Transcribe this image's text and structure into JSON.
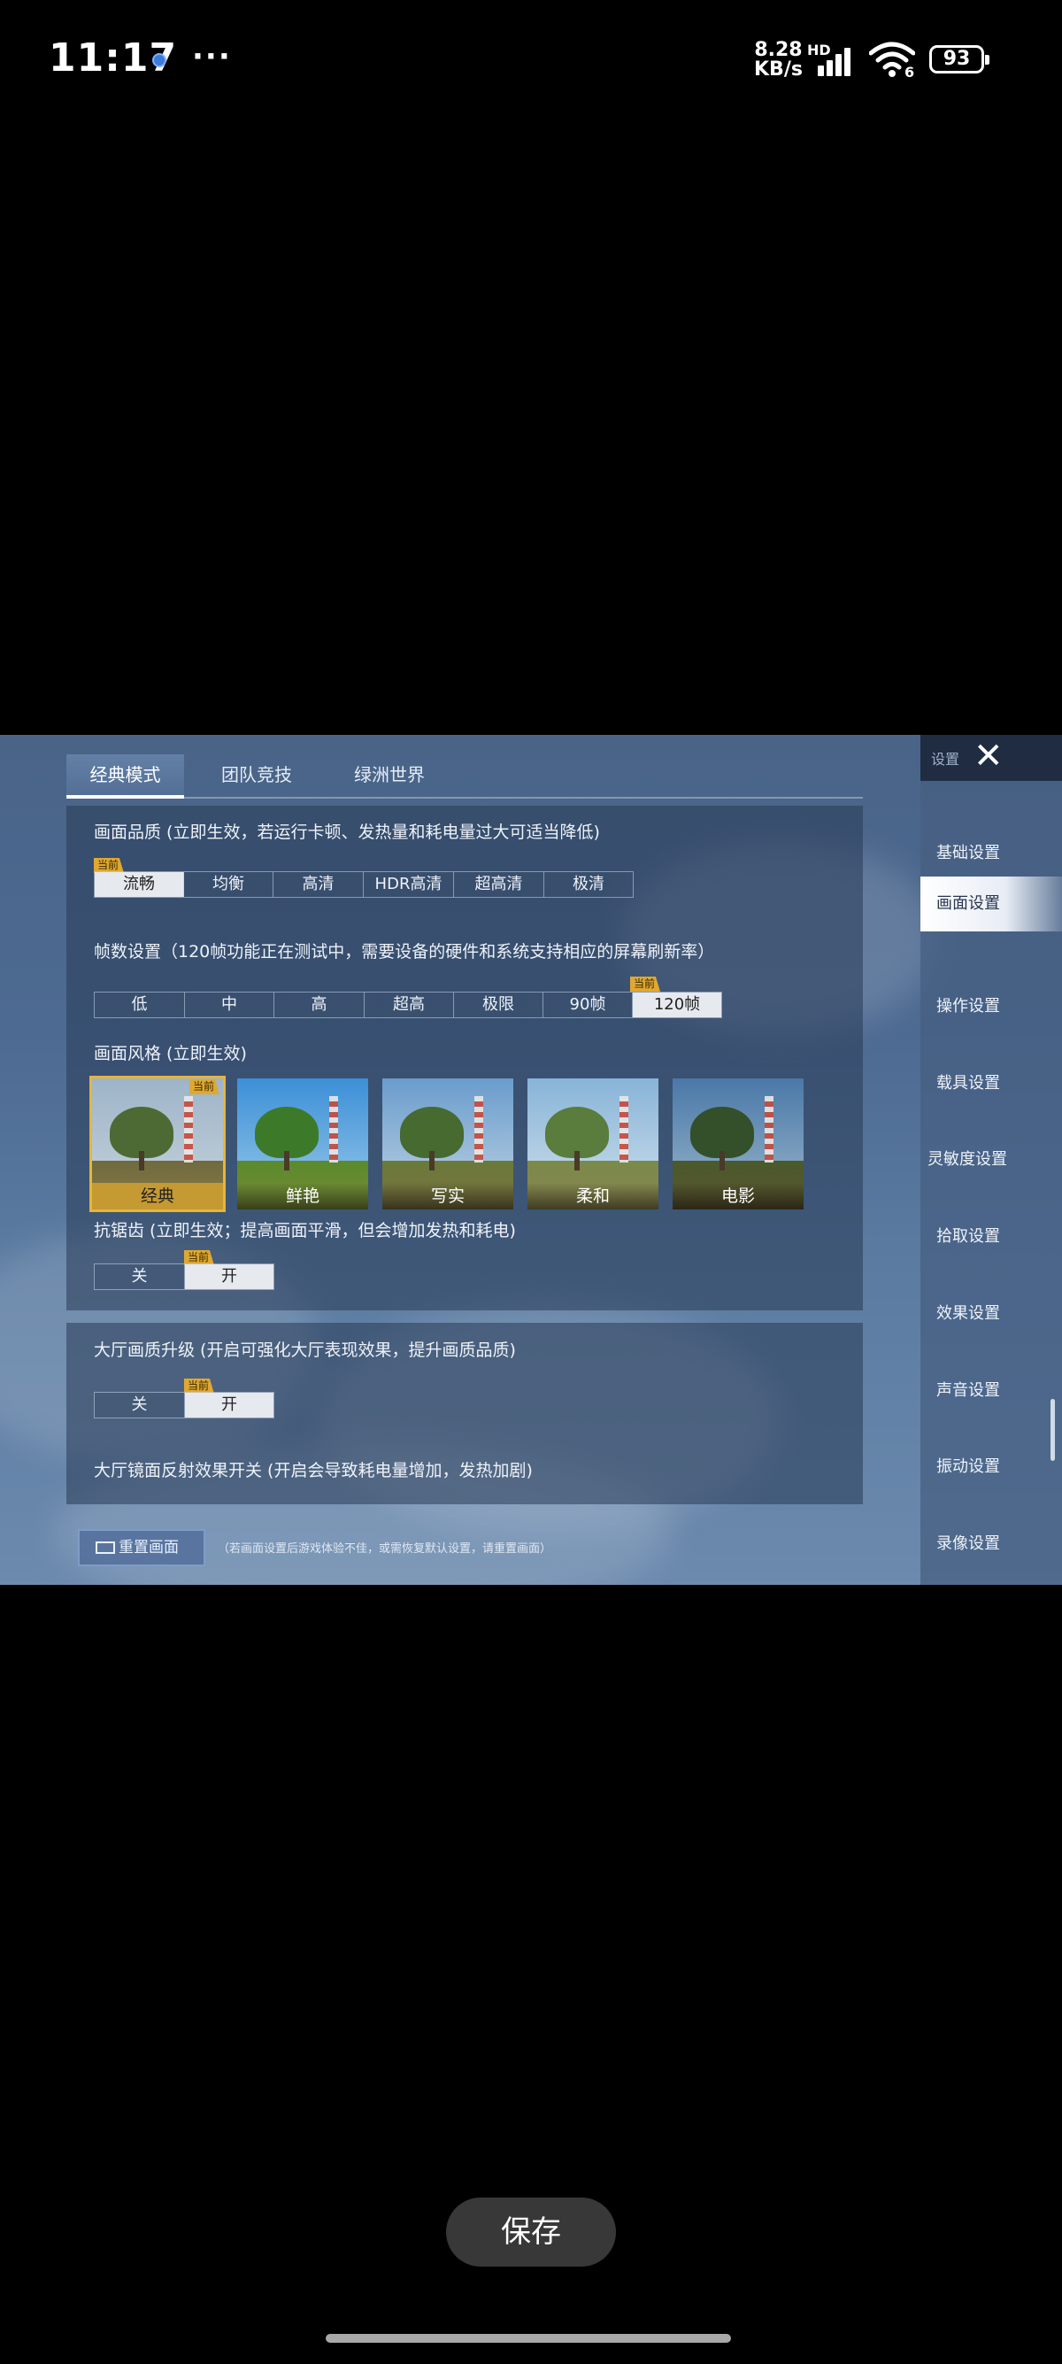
{
  "status_bar": {
    "time": "11:17",
    "more": "···",
    "net_speed_value": "8.28",
    "net_speed_unit": "KB/s",
    "network_badge": "HD",
    "wifi_badge": "6",
    "battery": "93"
  },
  "game": {
    "tabs": [
      {
        "label": "经典模式",
        "active": true
      },
      {
        "label": "团队竞技",
        "active": false
      },
      {
        "label": "绿洲世界",
        "active": false
      }
    ],
    "quality": {
      "label": "画面品质 (立即生效，若运行卡顿、发热量和耗电量过大可适当降低)",
      "current_tag": "当前",
      "options": [
        "流畅",
        "均衡",
        "高清",
        "HDR高清",
        "超高清",
        "极清"
      ],
      "selected": "流畅"
    },
    "fps": {
      "label": "帧数设置（120帧功能正在测试中，需要设备的硬件和系统支持相应的屏幕刷新率）",
      "current_tag": "当前",
      "options": [
        "低",
        "中",
        "高",
        "超高",
        "极限",
        "90帧",
        "120帧"
      ],
      "selected": "120帧"
    },
    "style": {
      "label": "画面风格 (立即生效)",
      "current_tag": "当前",
      "options": [
        "经典",
        "鲜艳",
        "写实",
        "柔和",
        "电影"
      ],
      "selected": "经典"
    },
    "antialias": {
      "label": "抗锯齿 (立即生效；提高画面平滑，但会增加发热和耗电)",
      "current_tag": "当前",
      "options": [
        "关",
        "开"
      ],
      "selected": "开"
    },
    "lobby_quality": {
      "label": "大厅画质升级 (开启可强化大厅表现效果，提升画质品质)",
      "current_tag": "当前",
      "options": [
        "关",
        "开"
      ],
      "selected": "开"
    },
    "lobby_reflection": {
      "label": "大厅镜面反射效果开关 (开启会导致耗电量增加，发热加剧)"
    },
    "reset": {
      "label": "重置画面",
      "note": "（若画面设置后游戏体验不佳，或需恢复默认设置，请重置画面）"
    },
    "sidebar": {
      "title": "设置",
      "items": [
        "基础设置",
        "画面设置",
        "操作设置",
        "载具设置",
        "灵敏度设置",
        "拾取设置",
        "效果设置",
        "声音设置",
        "振动设置",
        "录像设置"
      ],
      "active": "画面设置"
    }
  },
  "save_button": "保存",
  "colors": {
    "accent_gold": "#e0a832",
    "selected_option": "#e6e9ee",
    "panel": "#283a56"
  }
}
